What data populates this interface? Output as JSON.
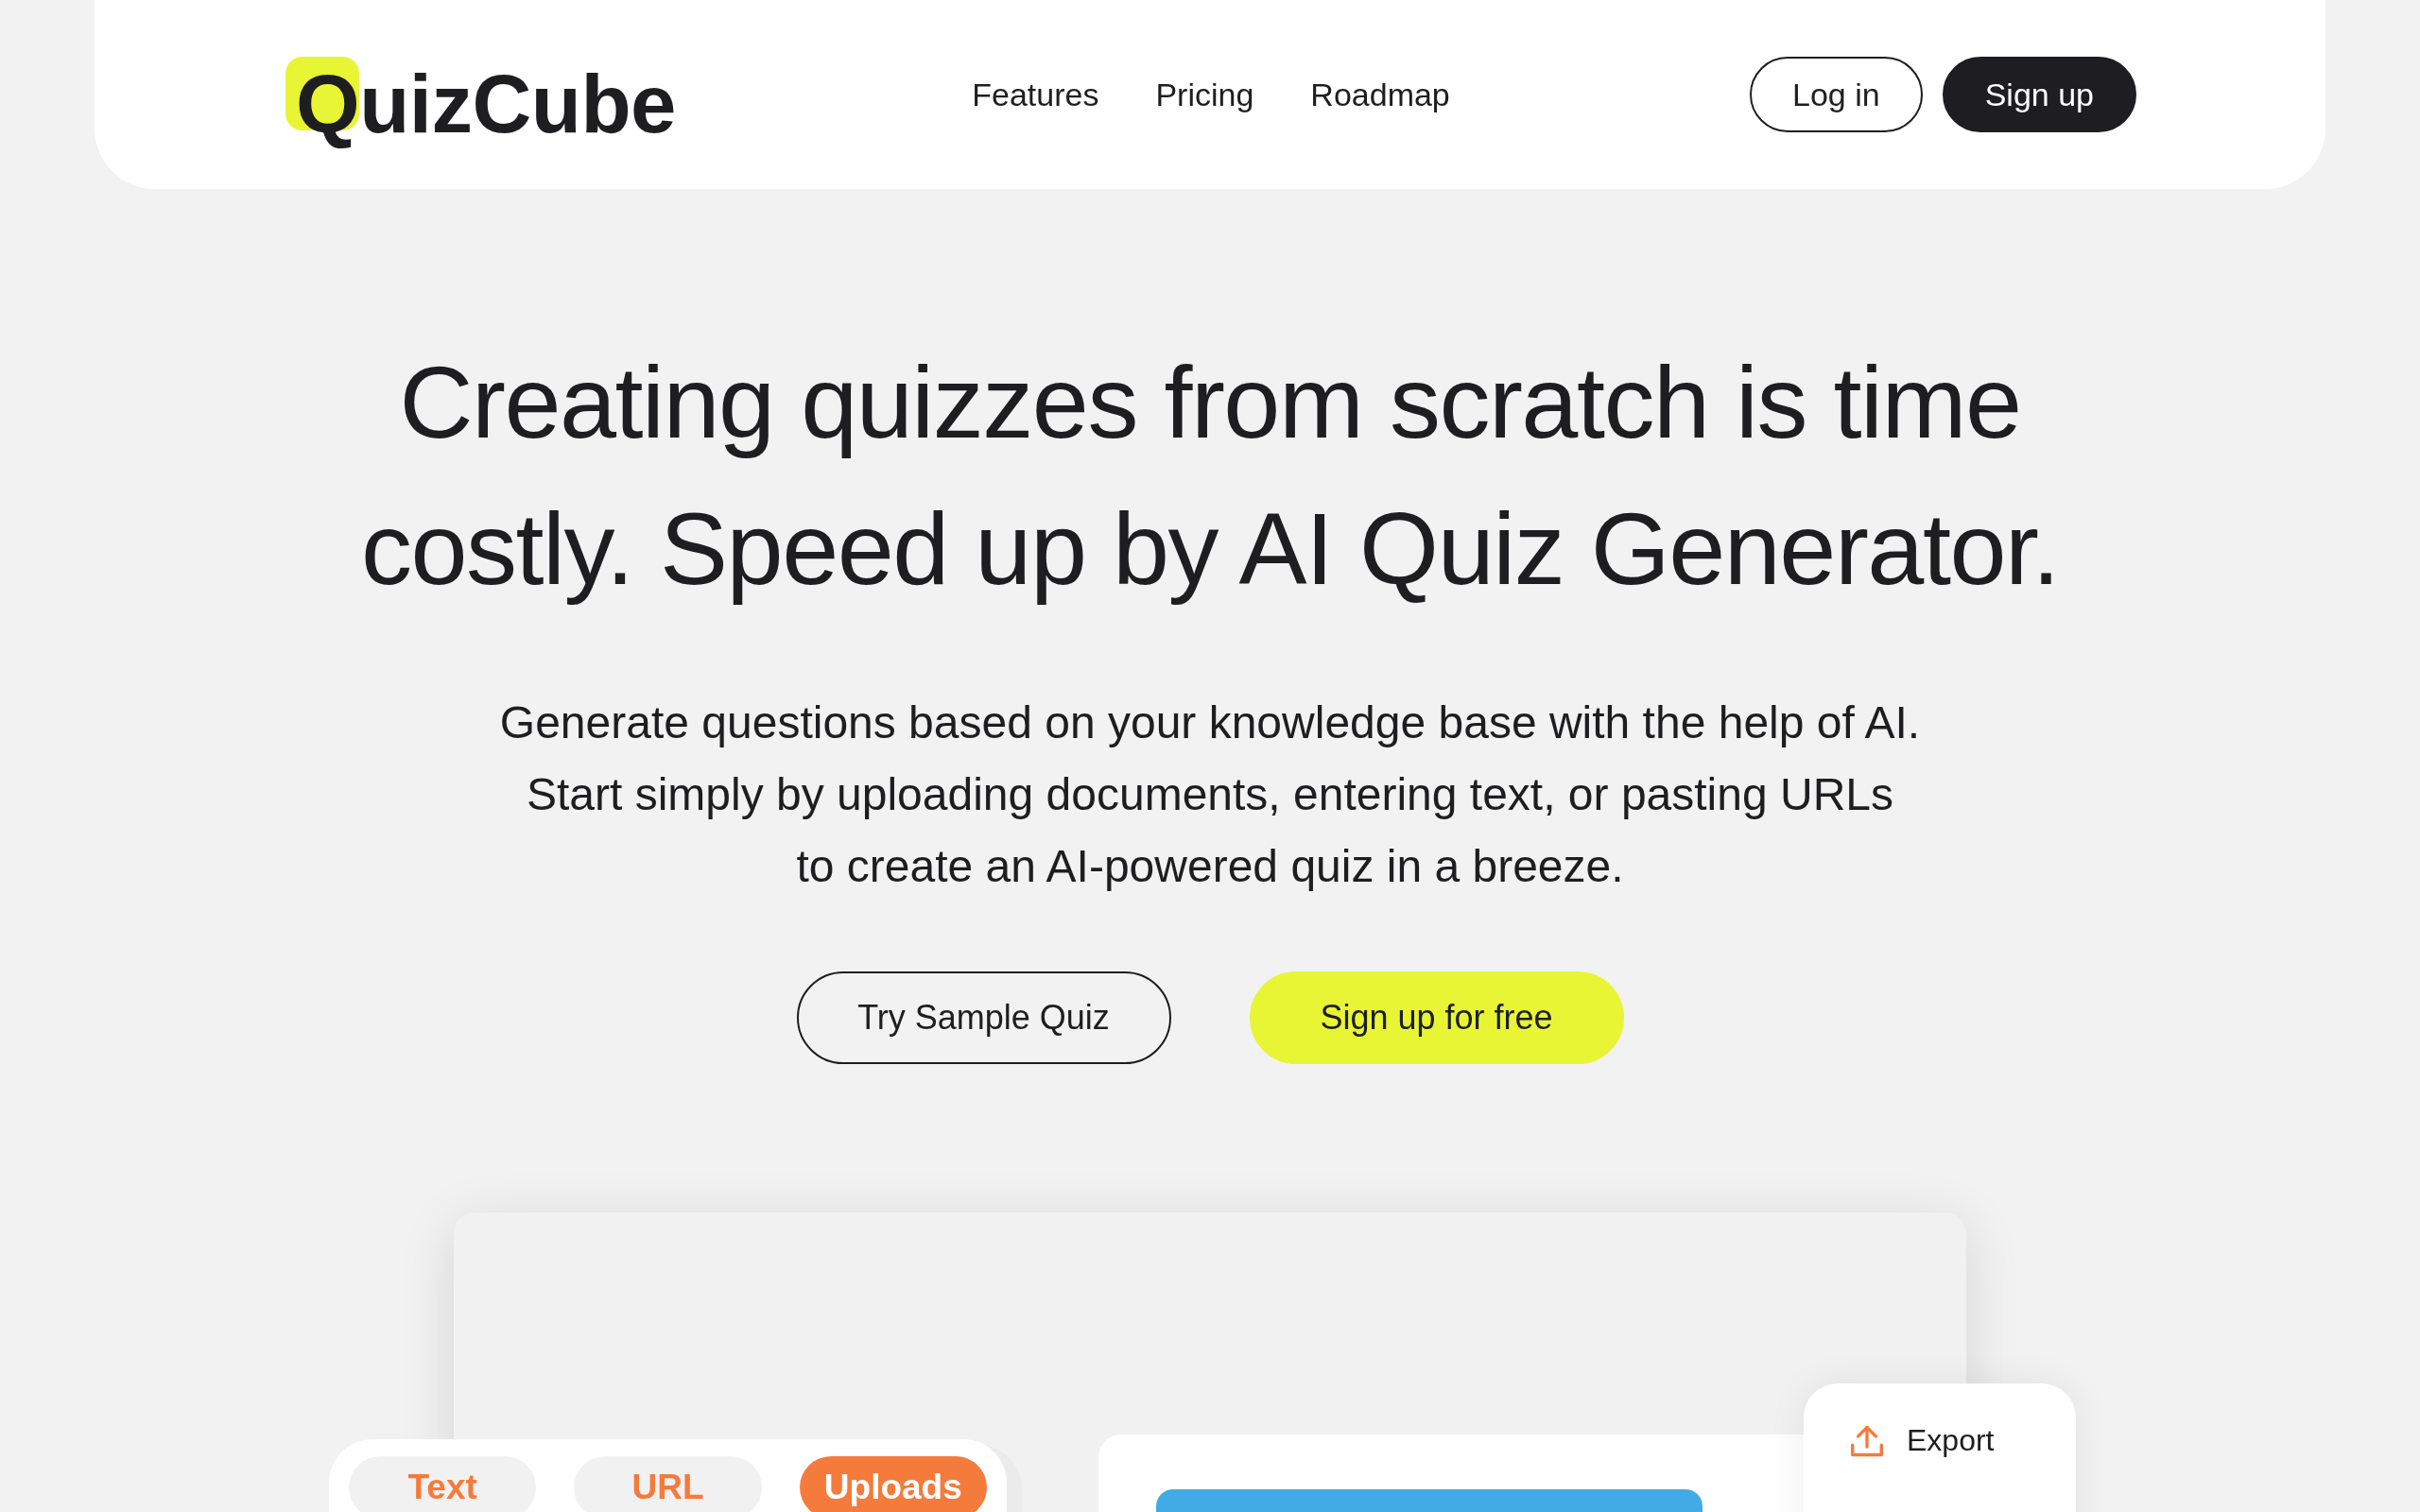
{
  "header": {
    "logo": "QuizCube",
    "nav": [
      "Features",
      "Pricing",
      "Roadmap"
    ],
    "actions": [
      {
        "label": "Log in",
        "kind": "outline"
      },
      {
        "label": "Sign up",
        "kind": "dark"
      }
    ]
  },
  "hero": {
    "title": "Creating quizzes from scratch is time costly. Speed up by AI Quiz Generator.",
    "subtitle": "Generate questions based on your knowledge base with the help of AI.\nStart simply by uploading documents, entering text, or pasting URLs\nto create an AI-powered quiz in a breeze.",
    "buttons": [
      {
        "label": "Try Sample Quiz",
        "kind": "outline"
      },
      {
        "label": "Sign up for free",
        "kind": "accent"
      }
    ]
  },
  "preview": {
    "tabs": [
      {
        "label": "Text",
        "selected": false
      },
      {
        "label": "URL",
        "selected": false
      },
      {
        "label": "Uploads",
        "selected": true
      }
    ],
    "menu": [
      {
        "label": "Export"
      }
    ]
  }
}
